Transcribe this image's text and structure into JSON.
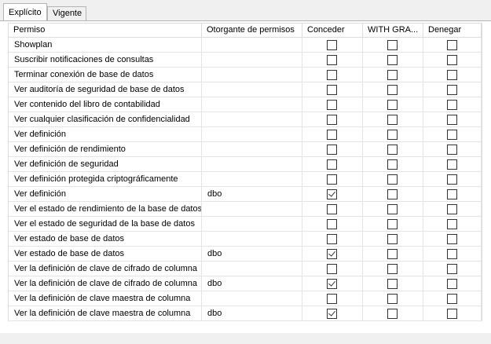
{
  "tabs": [
    {
      "label": "Explícito",
      "active": true
    },
    {
      "label": "Vigente",
      "active": false
    }
  ],
  "columns": [
    "Permiso",
    "Otorgante de permisos",
    "Conceder",
    "WITH GRA...",
    "Denegar"
  ],
  "rows": [
    {
      "permission": "Showplan",
      "grantor": "",
      "grant": false,
      "with_grant": false,
      "deny": false
    },
    {
      "permission": "Suscribir notificaciones de consultas",
      "grantor": "",
      "grant": false,
      "with_grant": false,
      "deny": false
    },
    {
      "permission": "Terminar conexión de base de datos",
      "grantor": "",
      "grant": false,
      "with_grant": false,
      "deny": false
    },
    {
      "permission": "Ver auditoría de seguridad de base de datos",
      "grantor": "",
      "grant": false,
      "with_grant": false,
      "deny": false
    },
    {
      "permission": "Ver contenido del libro de contabilidad",
      "grantor": "",
      "grant": false,
      "with_grant": false,
      "deny": false
    },
    {
      "permission": "Ver cualquier clasificación de confidencialidad",
      "grantor": "",
      "grant": false,
      "with_grant": false,
      "deny": false
    },
    {
      "permission": "Ver definición",
      "grantor": "",
      "grant": false,
      "with_grant": false,
      "deny": false
    },
    {
      "permission": "Ver definición de rendimiento",
      "grantor": "",
      "grant": false,
      "with_grant": false,
      "deny": false
    },
    {
      "permission": "Ver definición de seguridad",
      "grantor": "",
      "grant": false,
      "with_grant": false,
      "deny": false
    },
    {
      "permission": "Ver definición protegida criptográficamente",
      "grantor": "",
      "grant": false,
      "with_grant": false,
      "deny": false
    },
    {
      "permission": "Ver definición",
      "grantor": "dbo",
      "grant": true,
      "with_grant": false,
      "deny": false
    },
    {
      "permission": "Ver el estado de rendimiento de la base de datos",
      "grantor": "",
      "grant": false,
      "with_grant": false,
      "deny": false
    },
    {
      "permission": "Ver el estado de seguridad de la base de datos",
      "grantor": "",
      "grant": false,
      "with_grant": false,
      "deny": false
    },
    {
      "permission": "Ver estado de base de datos",
      "grantor": "",
      "grant": false,
      "with_grant": false,
      "deny": false
    },
    {
      "permission": "Ver estado de base de datos",
      "grantor": "dbo",
      "grant": true,
      "with_grant": false,
      "deny": false
    },
    {
      "permission": "Ver la definición de clave de cifrado de columna",
      "grantor": "",
      "grant": false,
      "with_grant": false,
      "deny": false
    },
    {
      "permission": "Ver la definición de clave de cifrado de columna",
      "grantor": "dbo",
      "grant": true,
      "with_grant": false,
      "deny": false
    },
    {
      "permission": "Ver la definición de clave maestra de columna",
      "grantor": "",
      "grant": false,
      "with_grant": false,
      "deny": false
    },
    {
      "permission": "Ver la definición de clave maestra de columna",
      "grantor": "dbo",
      "grant": true,
      "with_grant": false,
      "deny": false
    }
  ]
}
